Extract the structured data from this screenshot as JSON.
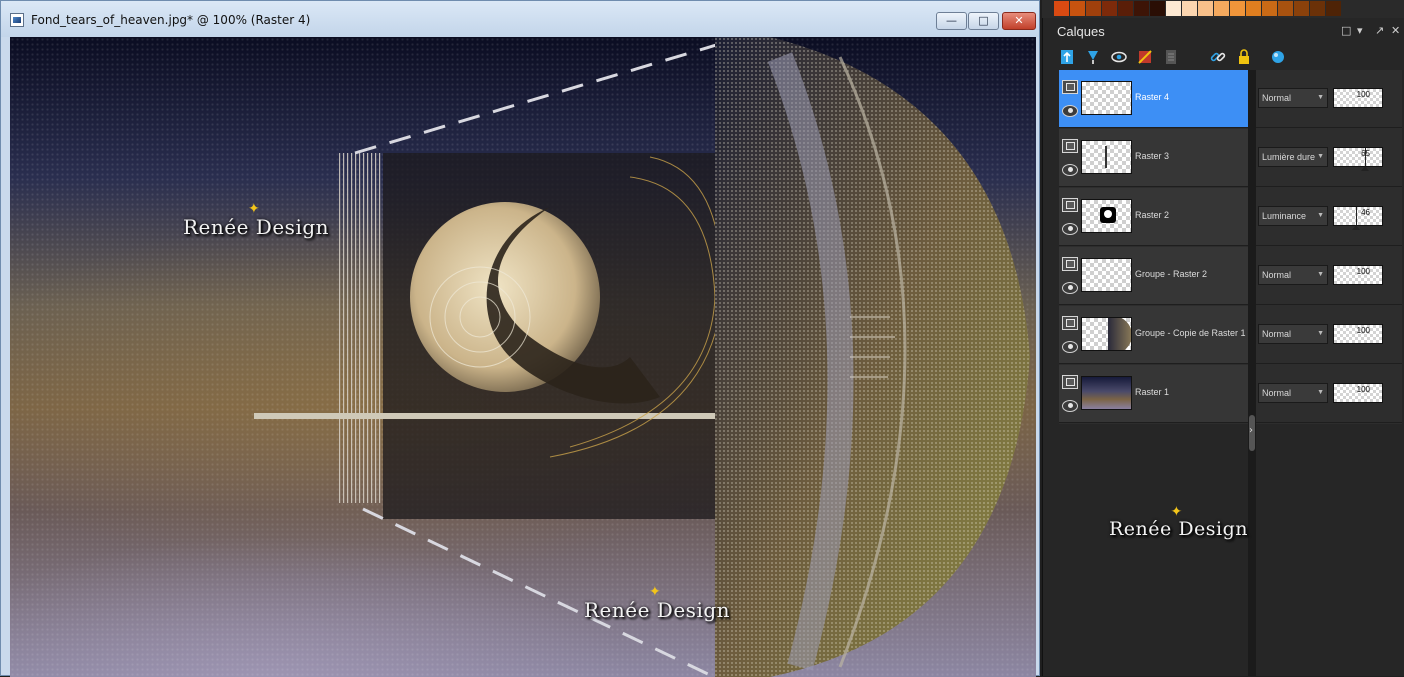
{
  "document": {
    "title": "Fond_tears_of_heaven.jpg* @ 100% (Raster 4)",
    "controls": {
      "minimize": "—",
      "maximize": "□",
      "close": "✕"
    }
  },
  "canvas": {
    "watermarks": [
      "Renée Design",
      "Renée Design"
    ]
  },
  "palette": {
    "swatches": [
      "#d94a12",
      "#c8530f",
      "#a0400c",
      "#7d2a0a",
      "#5a1e08",
      "#3d1406",
      "#2a0e04",
      "#fde9d2",
      "#fcd6b0",
      "#f8c08a",
      "#f4a95e",
      "#f0953a",
      "#e07e1f",
      "#c96a16",
      "#a8520f",
      "#8a410b",
      "#6b3108",
      "#4e2306"
    ]
  },
  "layers_panel": {
    "title": "Calques",
    "panel_controls": [
      "□",
      "▾",
      "↗",
      "✕"
    ],
    "toolbar": [
      "new-raster-layer-icon",
      "new-vector-layer-icon",
      "new-mask-layer-icon",
      "new-adjustment-layer-icon",
      "properties-icon",
      "link-icon",
      "lock-icon",
      "layer-styles-icon"
    ],
    "layers": [
      {
        "name": "Raster 4",
        "blend_mode": "Normal",
        "opacity": "100",
        "opacity_level": 100,
        "selected": true,
        "thumb": "empty"
      },
      {
        "name": "Raster 3",
        "blend_mode": "Lumière dure",
        "opacity": "65",
        "opacity_level": 65,
        "selected": false,
        "thumb": "line"
      },
      {
        "name": "Raster 2",
        "blend_mode": "Luminance",
        "opacity": "46",
        "opacity_level": 46,
        "selected": false,
        "thumb": "moon"
      },
      {
        "name": "Groupe - Raster 2",
        "blend_mode": "Normal",
        "opacity": "100",
        "opacity_level": 100,
        "selected": false,
        "thumb": "empty"
      },
      {
        "name": "Groupe - Copie de Raster 1",
        "blend_mode": "Normal",
        "opacity": "100",
        "opacity_level": 100,
        "selected": false,
        "thumb": "sphere"
      },
      {
        "name": "Raster 1",
        "blend_mode": "Normal",
        "opacity": "100",
        "opacity_level": 100,
        "selected": false,
        "thumb": "background"
      }
    ],
    "watermark": "Renée Design"
  }
}
